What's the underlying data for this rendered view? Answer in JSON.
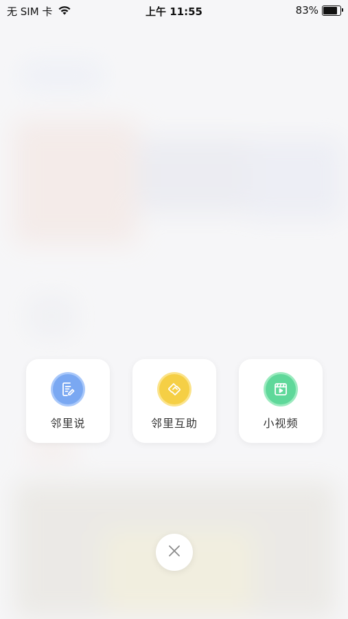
{
  "status_bar": {
    "carrier": "无 SIM 卡",
    "time": "上午 11:55",
    "battery_percent_label": "83%",
    "battery_level": 0.83
  },
  "actions": [
    {
      "label": "邻里说",
      "icon": "note-edit-icon",
      "color": "#7aa8f2",
      "color_light": "#a9c8fa"
    },
    {
      "label": "邻里互助",
      "icon": "handshake-icon",
      "color": "#f5cf45",
      "color_light": "#fbe38a"
    },
    {
      "label": "小视频",
      "icon": "video-icon",
      "color": "#5fd89a",
      "color_light": "#9ceabf"
    }
  ],
  "close": {
    "icon": "close-icon"
  }
}
